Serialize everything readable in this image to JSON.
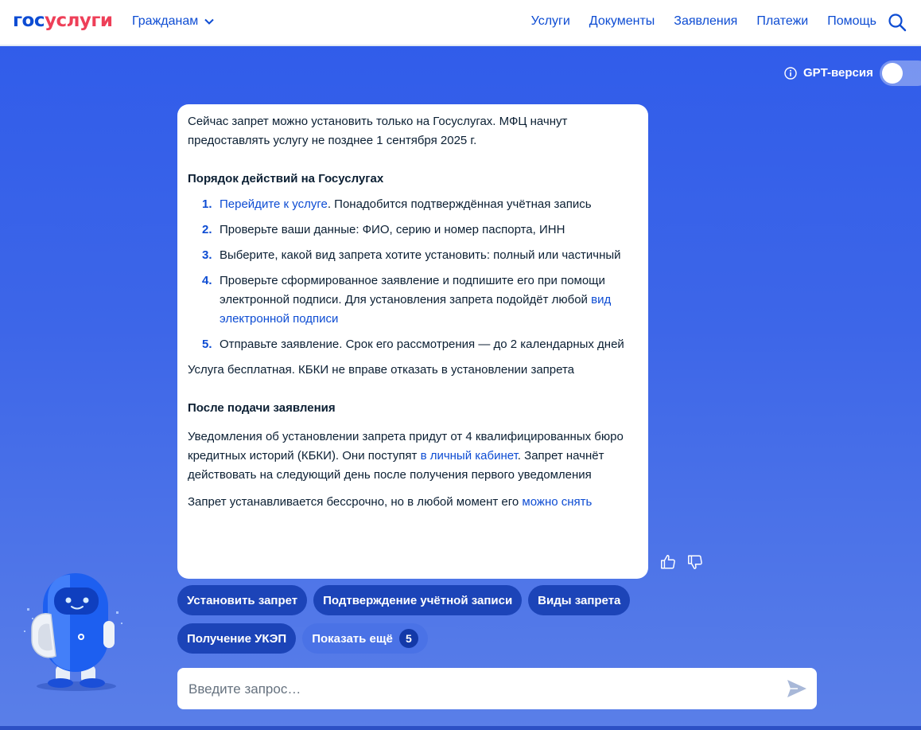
{
  "header": {
    "logo_part1": "гос",
    "logo_part2": "услуги",
    "audience": "Гражданам",
    "nav": [
      "Услуги",
      "Документы",
      "Заявления",
      "Платежи",
      "Помощь"
    ]
  },
  "gpt_toggle": {
    "label": "GPT-версия",
    "enabled": false
  },
  "message": {
    "intro": "Сейчас запрет можно установить только на Госуслугах. МФЦ начнут предоставлять услугу не позднее 1 сентября 2025 г.",
    "steps_title": "Порядок действий на Госуслугах",
    "steps": [
      {
        "num": "1.",
        "link": "Перейдите к услуге",
        "text": ". Понадобится подтверждённая учётная запись"
      },
      {
        "num": "2.",
        "text": "Проверьте ваши данные: ФИО, серию и номер паспорта, ИНН"
      },
      {
        "num": "3.",
        "text": "Выберите, какой вид запрета хотите установить: полный или частичный"
      },
      {
        "num": "4.",
        "text": "Проверьте сформированное заявление и подпишите его при помощи электронной подписи. Для установления запрета подойдёт любой ",
        "link": "вид электронной подписи"
      },
      {
        "num": "5.",
        "text": "Отправьте заявление. Срок его рассмотрения — до 2 календарных дней"
      }
    ],
    "free_note": "Услуга бесплатная. КБКИ не вправе отказать в установлении запрета",
    "after_title": "После подачи заявления",
    "after_text_1": "Уведомления об установлении запрета придут от 4 квалифицированных бюро кредитных историй (КБКИ). Они поступят ",
    "after_link": "в личный кабинет",
    "after_text_2": ". Запрет начнёт действовать на следующий день после получения первого уведомления",
    "final_text": "Запрет устанавливается бессрочно, но в любой момент его ",
    "final_link": "можно снять"
  },
  "chips_row1": [
    "Установить запрет",
    "Подтверждение учётной записи",
    "Виды запрета"
  ],
  "chips_row2": [
    "Получение УКЭП"
  ],
  "show_more": {
    "label": "Показать ещё",
    "count": "5"
  },
  "input": {
    "placeholder": "Введите запрос…",
    "value": ""
  },
  "colors": {
    "primary": "#0d4cd3",
    "accent_red": "#ee3f58",
    "chip": "#1c44b8",
    "background": "#3d66e8"
  }
}
